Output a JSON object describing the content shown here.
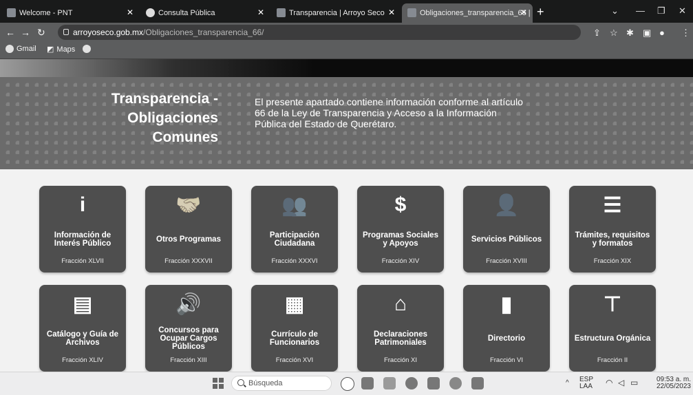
{
  "browser": {
    "tabs": [
      {
        "title": "Welcome - PNT"
      },
      {
        "title": "Consulta Pública"
      },
      {
        "title": "Transparencia | Arroyo Seco"
      },
      {
        "title": "Obligaciones_transparencia_66 |"
      }
    ],
    "new_tab": "+",
    "url_host": "arroyoseco.gob.mx",
    "url_path": "/Obligaciones_transparencia_66/",
    "bookmarks": [
      {
        "label": "Gmail"
      },
      {
        "label": "Maps"
      }
    ]
  },
  "hero": {
    "title_lines": [
      "Transparencia -",
      "Obligaciones",
      "Comunes"
    ],
    "description": "El presente apartado contiene información conforme al artículo 66 de la Ley de Transparencia y Acceso a la Información Pública del Estado de Querétaro."
  },
  "tiles": [
    {
      "icon": "info-icon",
      "glyph": "i",
      "label": "Información de Interés Público",
      "fraction": "Fracción XLVII"
    },
    {
      "icon": "handshake-icon",
      "glyph": "🤝",
      "label": "Otros Programas",
      "fraction": "Fracción XXXVII"
    },
    {
      "icon": "users-gear-icon",
      "glyph": "👥",
      "label": "Participación Ciudadana",
      "fraction": "Fracción XXXVI"
    },
    {
      "icon": "hand-dollar-icon",
      "glyph": "$",
      "label": "Programas Sociales y Apoyos",
      "fraction": "Fracción XIV"
    },
    {
      "icon": "user-gear-icon",
      "glyph": "👤",
      "label": "Servicios Públicos",
      "fraction": "Fracción XVIII"
    },
    {
      "icon": "checklist-icon",
      "glyph": "☰",
      "label": "Trámites, requisitos y formatos",
      "fraction": "Fracción XIX"
    },
    {
      "icon": "book-icon",
      "glyph": "▤",
      "label": "Catálogo y Guía de Archivos",
      "fraction": "Fracción XLIV"
    },
    {
      "icon": "audio-file-icon",
      "glyph": "🔊",
      "label": "Concursos para Ocupar Cargos Públicos",
      "fraction": "Fracción XIII"
    },
    {
      "icon": "id-card-icon",
      "glyph": "▦",
      "label": "Currículo de Funcionarios",
      "fraction": "Fracción XVI"
    },
    {
      "icon": "house-user-icon",
      "glyph": "⌂",
      "label": "Declaraciones Patrimoniales",
      "fraction": "Fracción XI"
    },
    {
      "icon": "address-book-icon",
      "glyph": "▮",
      "label": "Directorio",
      "fraction": "Fracción VI"
    },
    {
      "icon": "org-chart-icon",
      "glyph": "⊤",
      "label": "Estructura Orgánica",
      "fraction": "Fracción II"
    }
  ],
  "taskbar": {
    "search_placeholder": "Búsqueda",
    "lang_top": "ESP",
    "lang_bottom": "LAA",
    "time": "09:53 a. m.",
    "date": "22/05/2023"
  }
}
